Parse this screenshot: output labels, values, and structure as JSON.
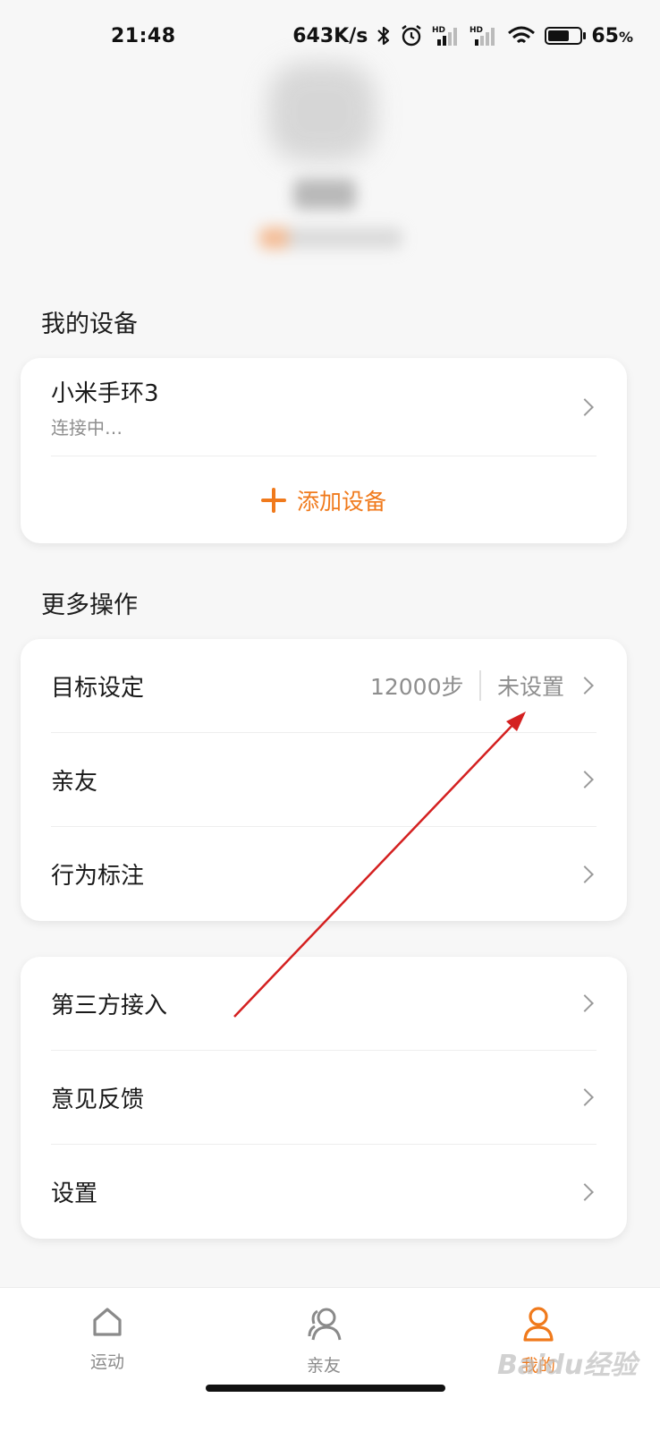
{
  "status_bar": {
    "time": "21:48",
    "speed": "643K/s",
    "battery": "65",
    "battery_unit": "%",
    "net_badge_1": "HD",
    "net_badge_2": "HD"
  },
  "sections": {
    "devices_title": "我的设备",
    "more_title": "更多操作"
  },
  "device": {
    "name": "小米手环3",
    "status": "连接中…",
    "add_label": "添加设备"
  },
  "more_actions": [
    {
      "label": "目标设定",
      "value": "12000步",
      "status": "未设置"
    },
    {
      "label": "亲友"
    },
    {
      "label": "行为标注"
    }
  ],
  "other_actions": [
    {
      "label": "第三方接入"
    },
    {
      "label": "意见反馈"
    },
    {
      "label": "设置"
    }
  ],
  "bottom_nav": [
    {
      "label": "运动",
      "icon": "home-icon",
      "active": false
    },
    {
      "label": "亲友",
      "icon": "friends-icon",
      "active": false
    },
    {
      "label": "我的",
      "icon": "profile-icon",
      "active": true
    }
  ],
  "colors": {
    "accent": "#f07a1c",
    "annotation": "#d42020"
  },
  "watermark": "Baidu经验"
}
